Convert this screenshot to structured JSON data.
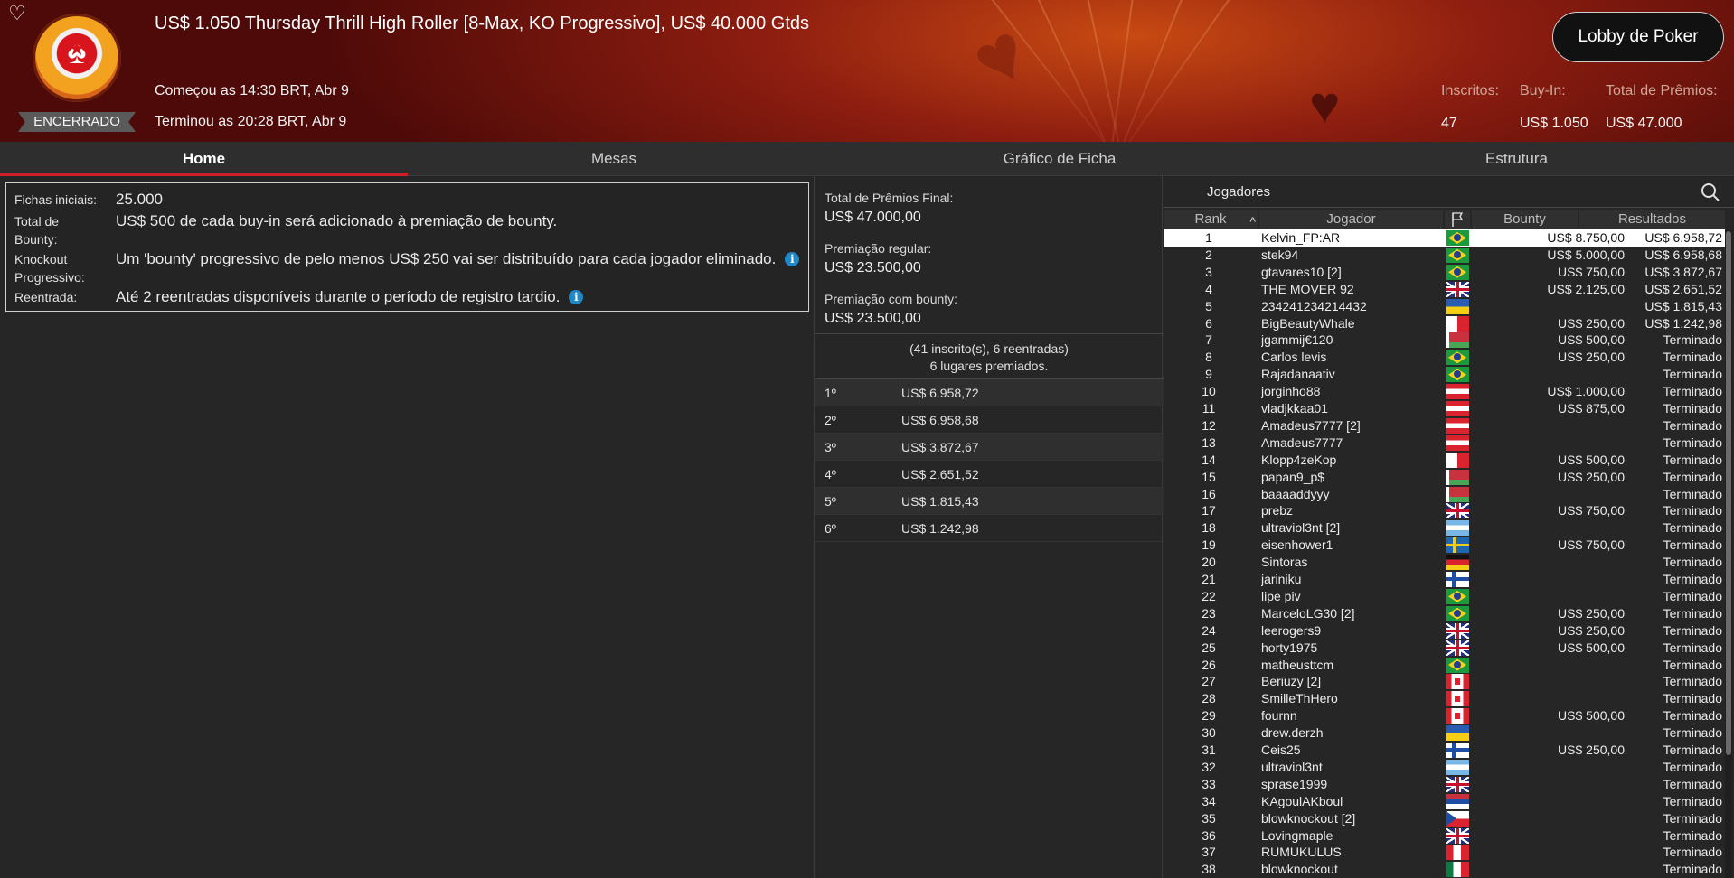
{
  "header": {
    "title": "US$ 1.050 Thursday Thrill High Roller [8-Max, KO Progressivo], US$ 40.000 Gtds",
    "status": "ENCERRADO",
    "started": "Começou as 14:30 BRT, Abr 9",
    "ended": "Terminou as 20:28 BRT, Abr 9",
    "lobby_button": "Lobby de Poker",
    "stats": [
      {
        "label": "Inscritos:",
        "value": "47"
      },
      {
        "label": "Buy-In:",
        "value": "US$ 1.050"
      },
      {
        "label": "Total de Prêmios:",
        "value": "US$ 47.000"
      }
    ],
    "icons": {
      "favorite": "heart-icon",
      "logo": "pokerstars-logo"
    }
  },
  "tabs": [
    {
      "label": "Home",
      "active": true
    },
    {
      "label": "Mesas",
      "active": false
    },
    {
      "label": "Gráfico de Ficha",
      "active": false
    },
    {
      "label": "Estrutura",
      "active": false
    }
  ],
  "info": {
    "starting_chips_label": "Fichas iniciais:",
    "starting_chips_value": "25.000",
    "bounty_total_label": "Total de Bounty:",
    "bounty_total_value": "US$ 500 de cada buy-in será adicionado à premiação de bounty.",
    "knockout_label": "Knockout Progressivo:",
    "knockout_value": "Um 'bounty' progressivo de pelo menos US$ 250 vai ser distribuído para cada jogador eliminado.",
    "reentry_label": "Reentrada:",
    "reentry_value": "Até 2 reentradas disponíveis durante o período de registro tardio.",
    "info_icon_glyph": "i"
  },
  "prizes": {
    "final_total_label": "Total de Prêmios Final:",
    "final_total_value": "US$ 47.000,00",
    "regular_label": "Premiação regular:",
    "regular_value": "US$ 23.500,00",
    "bounty_label": "Premiação com bounty:",
    "bounty_value": "US$ 23.500,00",
    "summary_line1": "(41 inscrito(s), 6 reentradas)",
    "summary_line2": "6 lugares premiados.",
    "places": [
      {
        "place": "1º",
        "amount": "US$ 6.958,72"
      },
      {
        "place": "2º",
        "amount": "US$ 6.958,68"
      },
      {
        "place": "3º",
        "amount": "US$ 3.872,67"
      },
      {
        "place": "4º",
        "amount": "US$ 2.651,52"
      },
      {
        "place": "5º",
        "amount": "US$ 1.815,43"
      },
      {
        "place": "6º",
        "amount": "US$ 1.242,98"
      }
    ]
  },
  "players": {
    "title": "Jogadores",
    "columns": {
      "rank": "Rank",
      "player": "Jogador",
      "bounty": "Bounty",
      "results": "Resultados"
    },
    "rows": [
      {
        "rank": "1",
        "name": "Kelvin_FP:AR",
        "flag": "br",
        "bounty": "US$ 8.750,00",
        "result": "US$ 6.958,72"
      },
      {
        "rank": "2",
        "name": "stek94",
        "flag": "br",
        "bounty": "US$ 5.000,00",
        "result": "US$ 6.958,68"
      },
      {
        "rank": "3",
        "name": "gtavares10 [2]",
        "flag": "br",
        "bounty": "US$ 750,00",
        "result": "US$ 3.872,67"
      },
      {
        "rank": "4",
        "name": "THE MOVER 92",
        "flag": "gb",
        "bounty": "US$ 2.125,00",
        "result": "US$ 2.651,52"
      },
      {
        "rank": "5",
        "name": "234241234214432",
        "flag": "ua",
        "bounty": "",
        "result": "US$ 1.815,43"
      },
      {
        "rank": "6",
        "name": "BigBeautyWhale",
        "flag": "mt",
        "bounty": "US$ 250,00",
        "result": "US$ 1.242,98"
      },
      {
        "rank": "7",
        "name": "jgammij€120",
        "flag": "by",
        "bounty": "US$ 500,00",
        "result": "Terminado"
      },
      {
        "rank": "8",
        "name": "Carlos levis",
        "flag": "br",
        "bounty": "US$ 250,00",
        "result": "Terminado"
      },
      {
        "rank": "9",
        "name": "Rajadanaativ",
        "flag": "br",
        "bounty": "",
        "result": "Terminado"
      },
      {
        "rank": "10",
        "name": "jorginho88",
        "flag": "at",
        "bounty": "US$ 1.000,00",
        "result": "Terminado"
      },
      {
        "rank": "11",
        "name": "vladjkkaa01",
        "flag": "at",
        "bounty": "US$ 875,00",
        "result": "Terminado"
      },
      {
        "rank": "12",
        "name": "Amadeus7777 [2]",
        "flag": "at",
        "bounty": "",
        "result": "Terminado"
      },
      {
        "rank": "13",
        "name": "Amadeus7777",
        "flag": "at",
        "bounty": "",
        "result": "Terminado"
      },
      {
        "rank": "14",
        "name": "Klopp4zeKop",
        "flag": "mt",
        "bounty": "US$ 500,00",
        "result": "Terminado"
      },
      {
        "rank": "15",
        "name": "papan9_p$",
        "flag": "by",
        "bounty": "US$ 250,00",
        "result": "Terminado"
      },
      {
        "rank": "16",
        "name": "baaaaddyyy",
        "flag": "by",
        "bounty": "",
        "result": "Terminado"
      },
      {
        "rank": "17",
        "name": "prebz",
        "flag": "gb",
        "bounty": "US$ 750,00",
        "result": "Terminado"
      },
      {
        "rank": "18",
        "name": "ultraviol3nt [2]",
        "flag": "ar",
        "bounty": "",
        "result": "Terminado"
      },
      {
        "rank": "19",
        "name": "eisenhower1",
        "flag": "se",
        "bounty": "US$ 750,00",
        "result": "Terminado"
      },
      {
        "rank": "20",
        "name": "Sintoras",
        "flag": "de",
        "bounty": "",
        "result": "Terminado"
      },
      {
        "rank": "21",
        "name": "jariniku",
        "flag": "fi",
        "bounty": "",
        "result": "Terminado"
      },
      {
        "rank": "22",
        "name": "lipe piv",
        "flag": "br",
        "bounty": "",
        "result": "Terminado"
      },
      {
        "rank": "23",
        "name": "MarceloLG30 [2]",
        "flag": "br",
        "bounty": "US$ 250,00",
        "result": "Terminado"
      },
      {
        "rank": "24",
        "name": "leerogers9",
        "flag": "gb",
        "bounty": "US$ 250,00",
        "result": "Terminado"
      },
      {
        "rank": "25",
        "name": "horty1975",
        "flag": "gb",
        "bounty": "US$ 500,00",
        "result": "Terminado"
      },
      {
        "rank": "26",
        "name": "matheusttcm",
        "flag": "br",
        "bounty": "",
        "result": "Terminado"
      },
      {
        "rank": "27",
        "name": "Beriuzy [2]",
        "flag": "ca",
        "bounty": "",
        "result": "Terminado"
      },
      {
        "rank": "28",
        "name": "SmilleThHero",
        "flag": "ca",
        "bounty": "",
        "result": "Terminado"
      },
      {
        "rank": "29",
        "name": "fournn",
        "flag": "ca",
        "bounty": "US$ 500,00",
        "result": "Terminado"
      },
      {
        "rank": "30",
        "name": "drew.derzh",
        "flag": "ua",
        "bounty": "",
        "result": "Terminado"
      },
      {
        "rank": "31",
        "name": "Ceis25",
        "flag": "fi",
        "bounty": "US$ 250,00",
        "result": "Terminado"
      },
      {
        "rank": "32",
        "name": "ultraviol3nt",
        "flag": "ar",
        "bounty": "",
        "result": "Terminado"
      },
      {
        "rank": "33",
        "name": "sprase1999",
        "flag": "gb",
        "bounty": "",
        "result": "Terminado"
      },
      {
        "rank": "34",
        "name": "KAgoulAKboul",
        "flag": "rs",
        "bounty": "",
        "result": "Terminado"
      },
      {
        "rank": "35",
        "name": "blowknockout [2]",
        "flag": "cz",
        "bounty": "",
        "result": "Terminado"
      },
      {
        "rank": "36",
        "name": "Lovingmaple",
        "flag": "gb",
        "bounty": "",
        "result": "Terminado"
      },
      {
        "rank": "37",
        "name": "RUMUKULUS",
        "flag": "pe",
        "bounty": "",
        "result": "Terminado"
      },
      {
        "rank": "38",
        "name": "blowknockout",
        "flag": "mx",
        "bounty": "",
        "result": "Terminado"
      }
    ]
  }
}
